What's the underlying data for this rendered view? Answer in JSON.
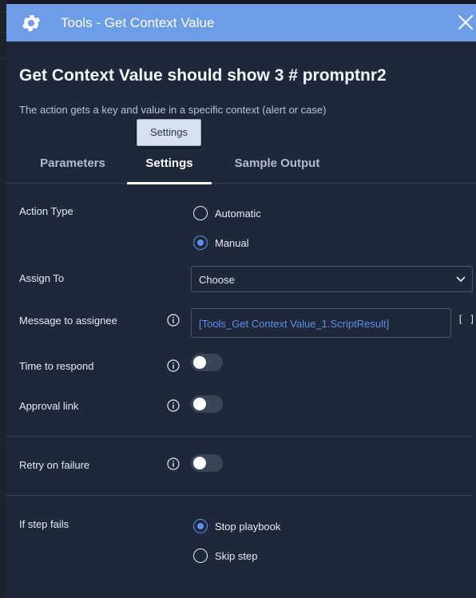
{
  "header": {
    "title": "Tools - Get Context Value",
    "icon": "gear-icon",
    "color": "#6c9de6"
  },
  "page": {
    "title": "Get Context Value should show 3 # promptnr2",
    "description": "The action gets a key and value in a specific context (alert or case)"
  },
  "tooltip": "Settings",
  "tabs": [
    {
      "label": "Parameters",
      "active": false
    },
    {
      "label": "Settings",
      "active": true
    },
    {
      "label": "Sample Output",
      "active": false
    }
  ],
  "settings": {
    "action_type": {
      "label": "Action Type",
      "options": [
        {
          "label": "Automatic",
          "selected": false
        },
        {
          "label": "Manual",
          "selected": true
        }
      ]
    },
    "assign_to": {
      "label": "Assign To",
      "value": "Choose"
    },
    "message": {
      "label": "Message to assignee",
      "value": "[Tools_Get Context Value_1.ScriptResult]",
      "brackets": "[ ]"
    },
    "time_to_respond": {
      "label": "Time to respond",
      "enabled": false
    },
    "approval_link": {
      "label": "Approval link",
      "enabled": false
    },
    "retry": {
      "label": "Retry on failure",
      "enabled": false
    },
    "if_step_fails": {
      "label": "If step fails",
      "options": [
        {
          "label": "Stop playbook",
          "selected": true
        },
        {
          "label": "Skip step",
          "selected": false
        }
      ]
    }
  },
  "colors": {
    "accent": "#5b8ff0",
    "panel": "#1f2838",
    "header": "#6c9de6"
  }
}
